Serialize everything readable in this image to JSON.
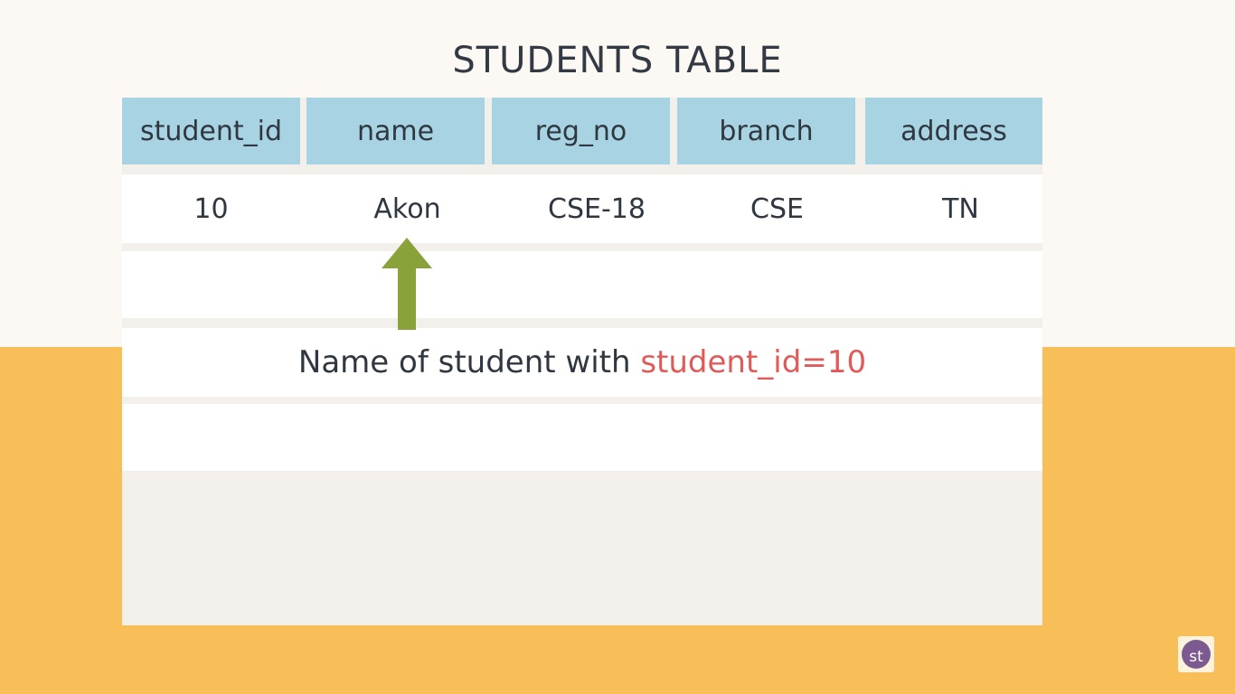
{
  "title": "STUDENTS TABLE",
  "table": {
    "columns": [
      "student_id",
      "name",
      "reg_no",
      "branch",
      "address"
    ],
    "rows": [
      [
        "10",
        "Akon",
        "CSE-18",
        "CSE",
        "TN"
      ]
    ]
  },
  "annotation": {
    "text": "Name of student with ",
    "highlight": "student_id=10",
    "arrow_icon": "up-arrow-icon"
  },
  "logo": {
    "text": "st"
  },
  "colors": {
    "header_bg": "#a8d3e3",
    "highlight": "#e05a5a",
    "arrow": "#8aa23a",
    "bottom_bg": "#f8bf58"
  }
}
